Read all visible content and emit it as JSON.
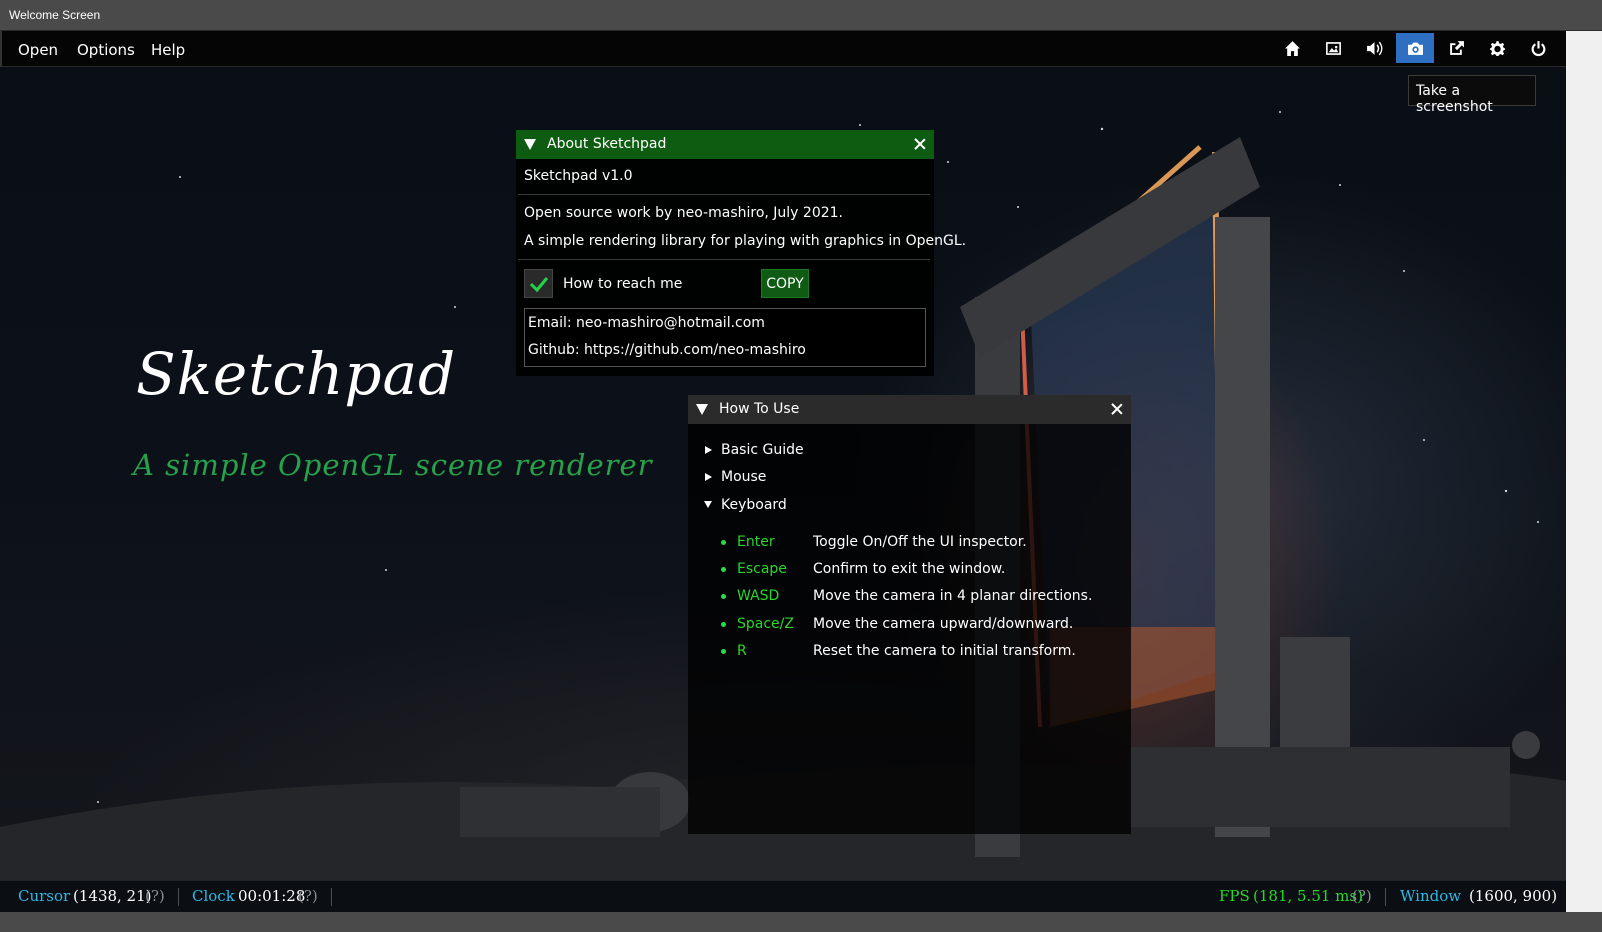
{
  "window": {
    "title": "Welcome Screen"
  },
  "menu": {
    "items": [
      "Open",
      "Options",
      "Help"
    ]
  },
  "toolbar": {
    "icons": [
      "home-icon",
      "image-icon",
      "volume-icon",
      "camera-icon",
      "external-link-icon",
      "settings-icon",
      "power-icon"
    ],
    "active": "camera-icon",
    "tooltip": "Take a screenshot"
  },
  "brand": {
    "title": "Sketchpad",
    "subtitle": "A simple OpenGL scene renderer",
    "subtitle_color": "#29a04a"
  },
  "about": {
    "title": "About Sketchpad",
    "version": "Sketchpad v1.0",
    "line1": "Open source work by neo-mashiro, July 2021.",
    "line2": "A simple rendering library for playing with graphics in OpenGL.",
    "checkbox_label": "How to reach me",
    "checkbox_checked": true,
    "copy_label": "COPY",
    "email": "Email: neo-mashiro@hotmail.com",
    "github": "Github: https://github.com/neo-mashiro",
    "header_color": "#0e5c12"
  },
  "howto": {
    "title": "How To Use",
    "tree": [
      {
        "label": "Basic Guide",
        "expanded": false
      },
      {
        "label": "Mouse",
        "expanded": false
      },
      {
        "label": "Keyboard",
        "expanded": true
      }
    ],
    "keys": [
      {
        "key": "Enter",
        "desc": "Toggle On/Off the UI inspector."
      },
      {
        "key": "Escape",
        "desc": "Confirm to exit the window."
      },
      {
        "key": "WASD",
        "desc": "Move the camera in 4 planar directions."
      },
      {
        "key": "Space/Z",
        "desc": "Move the camera upward/downward."
      },
      {
        "key": "R",
        "desc": "Reset the camera to initial transform."
      }
    ]
  },
  "status": {
    "cursor_label": "Cursor",
    "cursor_value": "(1438, 21)",
    "clock_label": "Clock",
    "clock_value": "00:01:28",
    "help": "(?)",
    "fps_label": "FPS",
    "fps_value": "(181, 5.51 ms)",
    "window_label": "Window",
    "window_value": "(1600, 900)"
  }
}
